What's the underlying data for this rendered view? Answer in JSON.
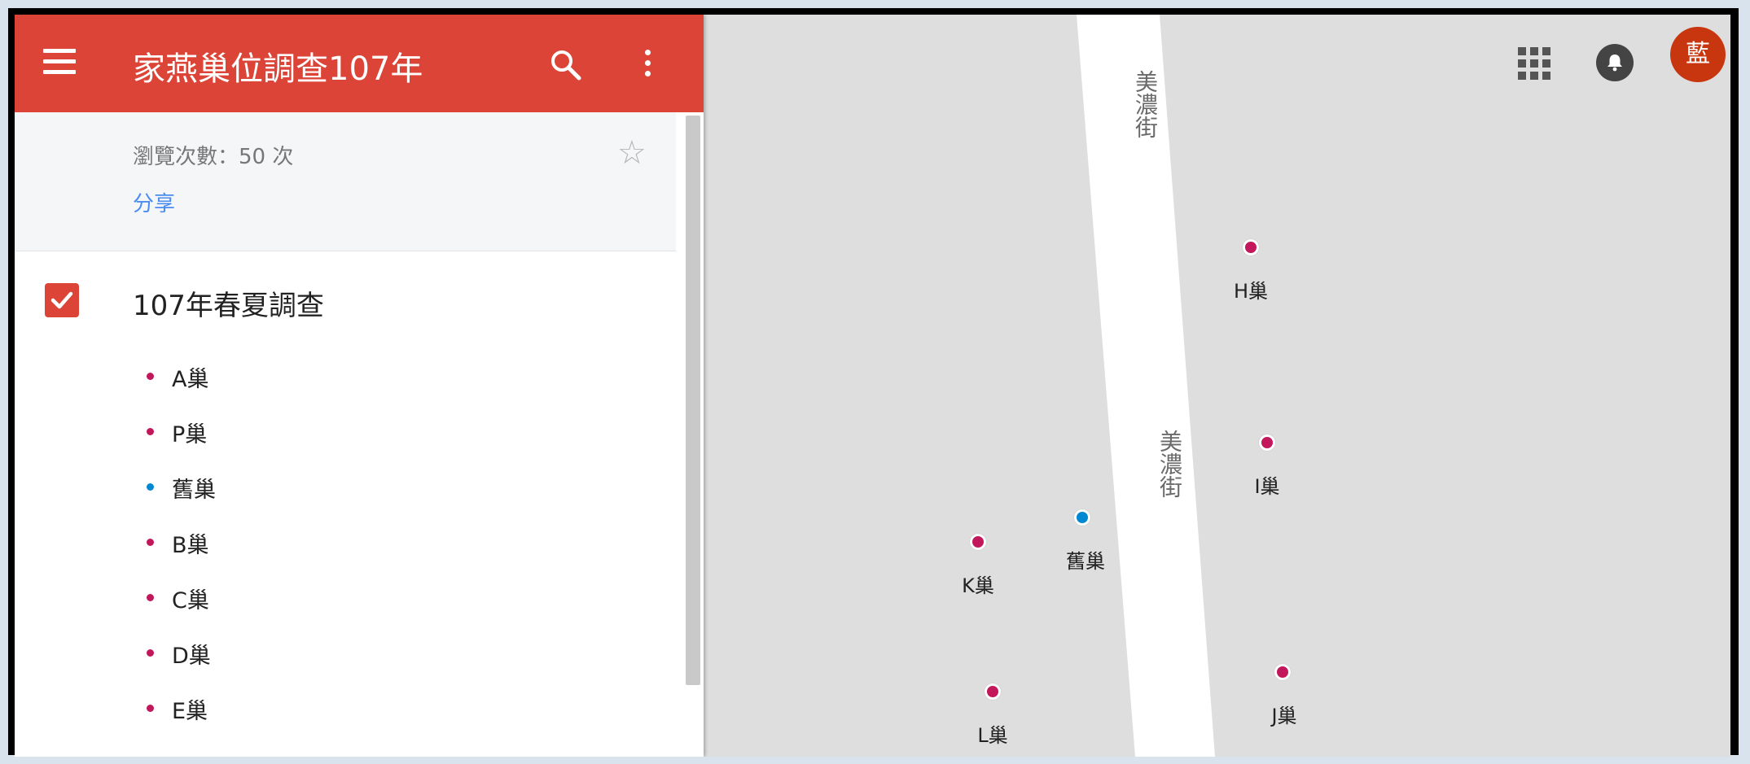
{
  "header": {
    "title": "家燕巢位調查107年",
    "menu_icon": "menu-icon",
    "search_icon": "search-icon",
    "more_icon": "more-vert-icon",
    "background": "#db4437"
  },
  "info": {
    "views": "瀏覽次數：50 次",
    "share": "分享",
    "star_icon": "star-outline-icon"
  },
  "layer": {
    "title": "107年春夏調查",
    "checked": true,
    "items": [
      {
        "label": "A巢",
        "color": "#c2185b"
      },
      {
        "label": "P巢",
        "color": "#c2185b"
      },
      {
        "label": "舊巢",
        "color": "#0288d1"
      },
      {
        "label": "B巢",
        "color": "#c2185b"
      },
      {
        "label": "C巢",
        "color": "#c2185b"
      },
      {
        "label": "D巢",
        "color": "#c2185b"
      },
      {
        "label": "E巢",
        "color": "#c2185b"
      }
    ]
  },
  "map": {
    "road_names": [
      "美濃街",
      "美濃街"
    ],
    "markers": [
      {
        "label": "H巢",
        "color": "#c2185b"
      },
      {
        "label": "I巢",
        "color": "#c2185b"
      },
      {
        "label": "舊巢",
        "color": "#0288d1"
      },
      {
        "label": "K巢",
        "color": "#c2185b"
      },
      {
        "label": "L巢",
        "color": "#c2185b"
      },
      {
        "label": "J巢",
        "color": "#c2185b"
      }
    ]
  },
  "account": {
    "apps_icon": "apps-icon",
    "notifications_icon": "notifications-icon",
    "avatar_text": "藍",
    "avatar_color": "#c8360f"
  }
}
